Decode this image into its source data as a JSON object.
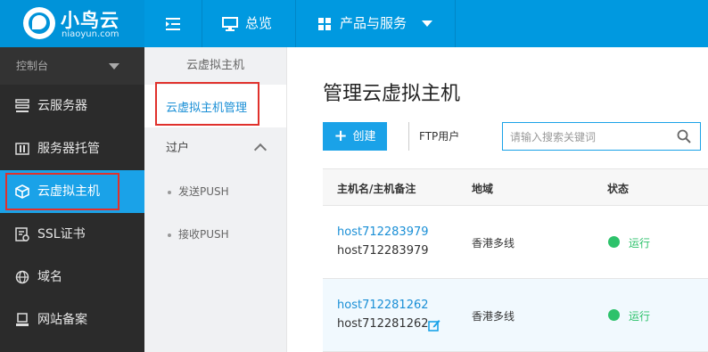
{
  "brand": {
    "name": "小鸟云",
    "domain": "niaoyun.com"
  },
  "topnav": {
    "overview": "总览",
    "products": "产品与服务"
  },
  "sidebar": {
    "header": "控制台",
    "items": [
      {
        "label": "云服务器",
        "icon": "server-stack-icon"
      },
      {
        "label": "服务器托管",
        "icon": "hosting-icon"
      },
      {
        "label": "云虚拟主机",
        "icon": "cube-icon",
        "active": true
      },
      {
        "label": "SSL证书",
        "icon": "certificate-icon"
      },
      {
        "label": "域名",
        "icon": "globe-icon"
      },
      {
        "label": "网站备案",
        "icon": "stamp-icon"
      }
    ]
  },
  "subnav": {
    "title": "云虚拟主机",
    "active": "云虚拟主机管理",
    "group": "过户",
    "subitems": [
      "发送PUSH",
      "接收PUSH"
    ]
  },
  "main": {
    "title": "管理云虚拟主机",
    "create_label": "创建",
    "ftp_label": "FTP用户",
    "search_placeholder": "请输入搜索关键词",
    "columns": [
      "主机名/主机备注",
      "地域",
      "状态"
    ],
    "rows": [
      {
        "host": "host712283979",
        "note": "host712283979",
        "region": "香港多线",
        "status": "运行"
      },
      {
        "host": "host712281262",
        "note": "host712281262",
        "region": "香港多线",
        "status": "运行"
      }
    ]
  },
  "colors": {
    "brand_blue": "#0099e0",
    "active_blue": "#1aa2e8",
    "status_green": "#2dc26b",
    "highlight_red": "#e0312c"
  }
}
